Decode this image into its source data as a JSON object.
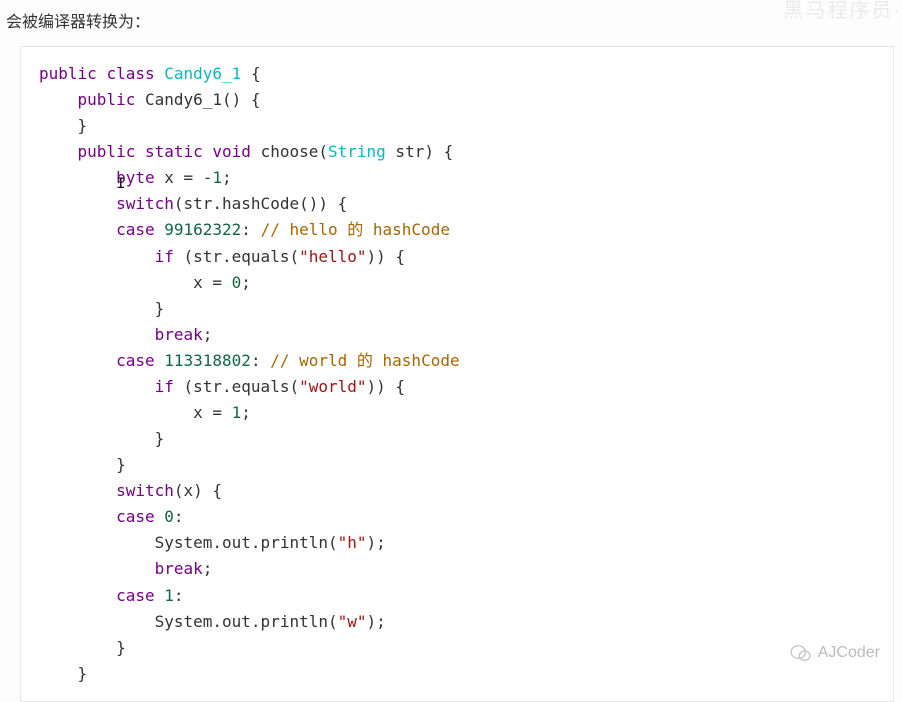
{
  "intro": "会被编译器转换为：",
  "watermark_top": "黑马程序员·",
  "watermark_bottom": "AJCoder",
  "code": {
    "l01_kw1": "public",
    "l01_kw2": "class",
    "l01_cls": "Candy6_1",
    "l01_rest": " {",
    "l02_kw": "public",
    "l02_ctor": "Candy6_1",
    "l02_rest": "() {",
    "l03": "    }",
    "l04_kw1": "public",
    "l04_kw2": "static",
    "l04_kw3": "void",
    "l04_name": " choose(",
    "l04_type": "String",
    "l04_rest": " str) {",
    "l05_pre": "        ",
    "l05_type": "byte",
    "l05_mid": " x = ",
    "l05_neg": "-",
    "l05_num": "1",
    "l05_end": ";",
    "l06_pre": "        ",
    "l06_kw": "switch",
    "l06_rest": "(str.hashCode()) {",
    "l07_pre": "        ",
    "l07_kw": "case",
    "l07_sp": " ",
    "l07_num": "99162322",
    "l07_colon": ": ",
    "l07_cmt": "// hello 的 hashCode",
    "l08_pre": "            ",
    "l08_kw": "if",
    "l08_mid": " (str.equals(",
    "l08_str": "\"hello\"",
    "l08_end": ")) {",
    "l09_pre": "                x = ",
    "l09_num": "0",
    "l09_end": ";",
    "l10": "            }",
    "l11_pre": "            ",
    "l11_kw": "break",
    "l11_end": ";",
    "l12_pre": "        ",
    "l12_kw": "case",
    "l12_sp": " ",
    "l12_num": "113318802",
    "l12_colon": ": ",
    "l12_cmt": "// world 的 hashCode",
    "l13_pre": "            ",
    "l13_kw": "if",
    "l13_mid": " (str.equals(",
    "l13_str": "\"world\"",
    "l13_end": ")) {",
    "l14_pre": "                x = ",
    "l14_num": "1",
    "l14_end": ";",
    "l15": "            }",
    "l16": "        }",
    "l17_pre": "        ",
    "l17_kw": "switch",
    "l17_rest": "(x) {",
    "l18_pre": "        ",
    "l18_kw": "case",
    "l18_sp": " ",
    "l18_num": "0",
    "l18_colon": ":",
    "l19_pre": "            System.out.println(",
    "l19_str": "\"h\"",
    "l19_end": ");",
    "l20_pre": "            ",
    "l20_kw": "break",
    "l20_end": ";",
    "l21_pre": "        ",
    "l21_kw": "case",
    "l21_sp": " ",
    "l21_num": "1",
    "l21_colon": ":",
    "l22_pre": "            System.out.println(",
    "l22_str": "\"w\"",
    "l22_end": ");",
    "l23": "        }",
    "l24": "    }"
  }
}
